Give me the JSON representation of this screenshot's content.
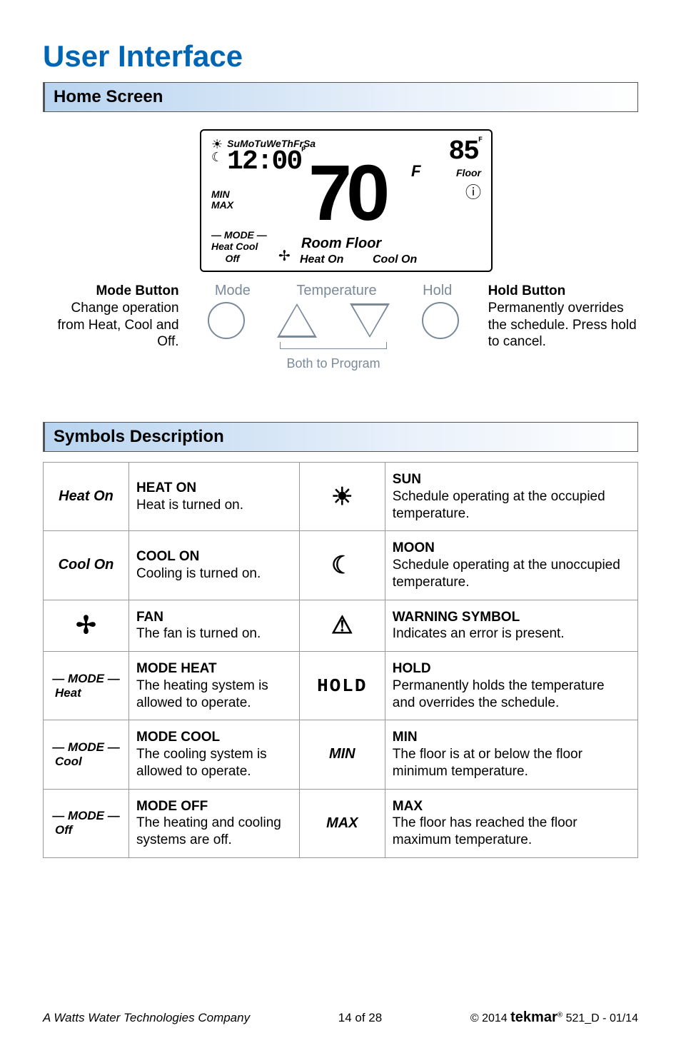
{
  "page_title": "User Interface",
  "sections": {
    "home": "Home Screen",
    "symbols": "Symbols Description"
  },
  "lcd": {
    "days": "SuMoTuWeThFrSa",
    "time": "12:00",
    "ampm": "P",
    "min": "MIN",
    "max": "MAX",
    "main_temp": "70",
    "main_unit": "F",
    "floor_temp": "85",
    "floor_unit": "F",
    "floor_label": "Floor",
    "mode_header": "— MODE —",
    "mode_heat": "Heat",
    "mode_cool": "Cool",
    "mode_off": "Off",
    "room_floor": "Room Floor",
    "heat_on": "Heat On",
    "cool_on": "Cool On"
  },
  "buttons": {
    "mode_title": "Mode Button",
    "mode_desc": "Change operation from Heat, Cool and Off.",
    "hold_title": "Hold Button",
    "hold_desc": "Permanently overrides the schedule. Press hold to cancel.",
    "label_mode": "Mode",
    "label_temp": "Temperature",
    "label_hold": "Hold",
    "both": "Both to Program"
  },
  "symbols_rows": [
    {
      "l_sym": "Heat On",
      "l_title": "HEAT ON",
      "l_desc": "Heat is turned on.",
      "r_sym": "☀",
      "r_title": "SUN",
      "r_desc": "Schedule operating at the occupied temperature.",
      "r_icon": true
    },
    {
      "l_sym": "Cool On",
      "l_title": "COOL ON",
      "l_desc": "Cooling is turned on.",
      "r_sym": "☾",
      "r_title": "MOON",
      "r_desc": "Schedule operating at the unoccupied temperature.",
      "r_icon": true
    },
    {
      "l_sym": "✢",
      "l_title": "FAN",
      "l_desc": "The fan is turned on.",
      "l_icon": true,
      "r_sym": "⚠",
      "r_title": "WARNING SYMBOL",
      "r_desc": "Indicates an error is present.",
      "r_icon": true
    },
    {
      "l_sym_top": "— MODE —",
      "l_sym_bot": "Heat",
      "l_title": "MODE HEAT",
      "l_desc": "The heating system is allowed to operate.",
      "r_sym": "HOLD",
      "r_seg": true,
      "r_title": "HOLD",
      "r_desc": "Permanently holds the temperature and overrides the schedule."
    },
    {
      "l_sym_top": "— MODE —",
      "l_sym_bot": "Cool",
      "l_title": "MODE COOL",
      "l_desc": "The cooling system is allowed to operate.",
      "r_sym": "MIN",
      "r_title": "MIN",
      "r_desc": "The floor is at or below the floor minimum temperature."
    },
    {
      "l_sym_top": "— MODE —",
      "l_sym_bot": "Off",
      "l_title": "MODE OFF",
      "l_desc": "The heating and cooling systems are off.",
      "r_sym": "MAX",
      "r_title": "MAX",
      "r_desc": "The floor has reached the floor maximum temperature."
    }
  ],
  "footer": {
    "company": "A Watts Water Technologies Company",
    "page": "14 of 28",
    "copyright": "© 2014",
    "brand": "tekmar",
    "reg": "®",
    "doc": " 521_D - 01/14"
  }
}
